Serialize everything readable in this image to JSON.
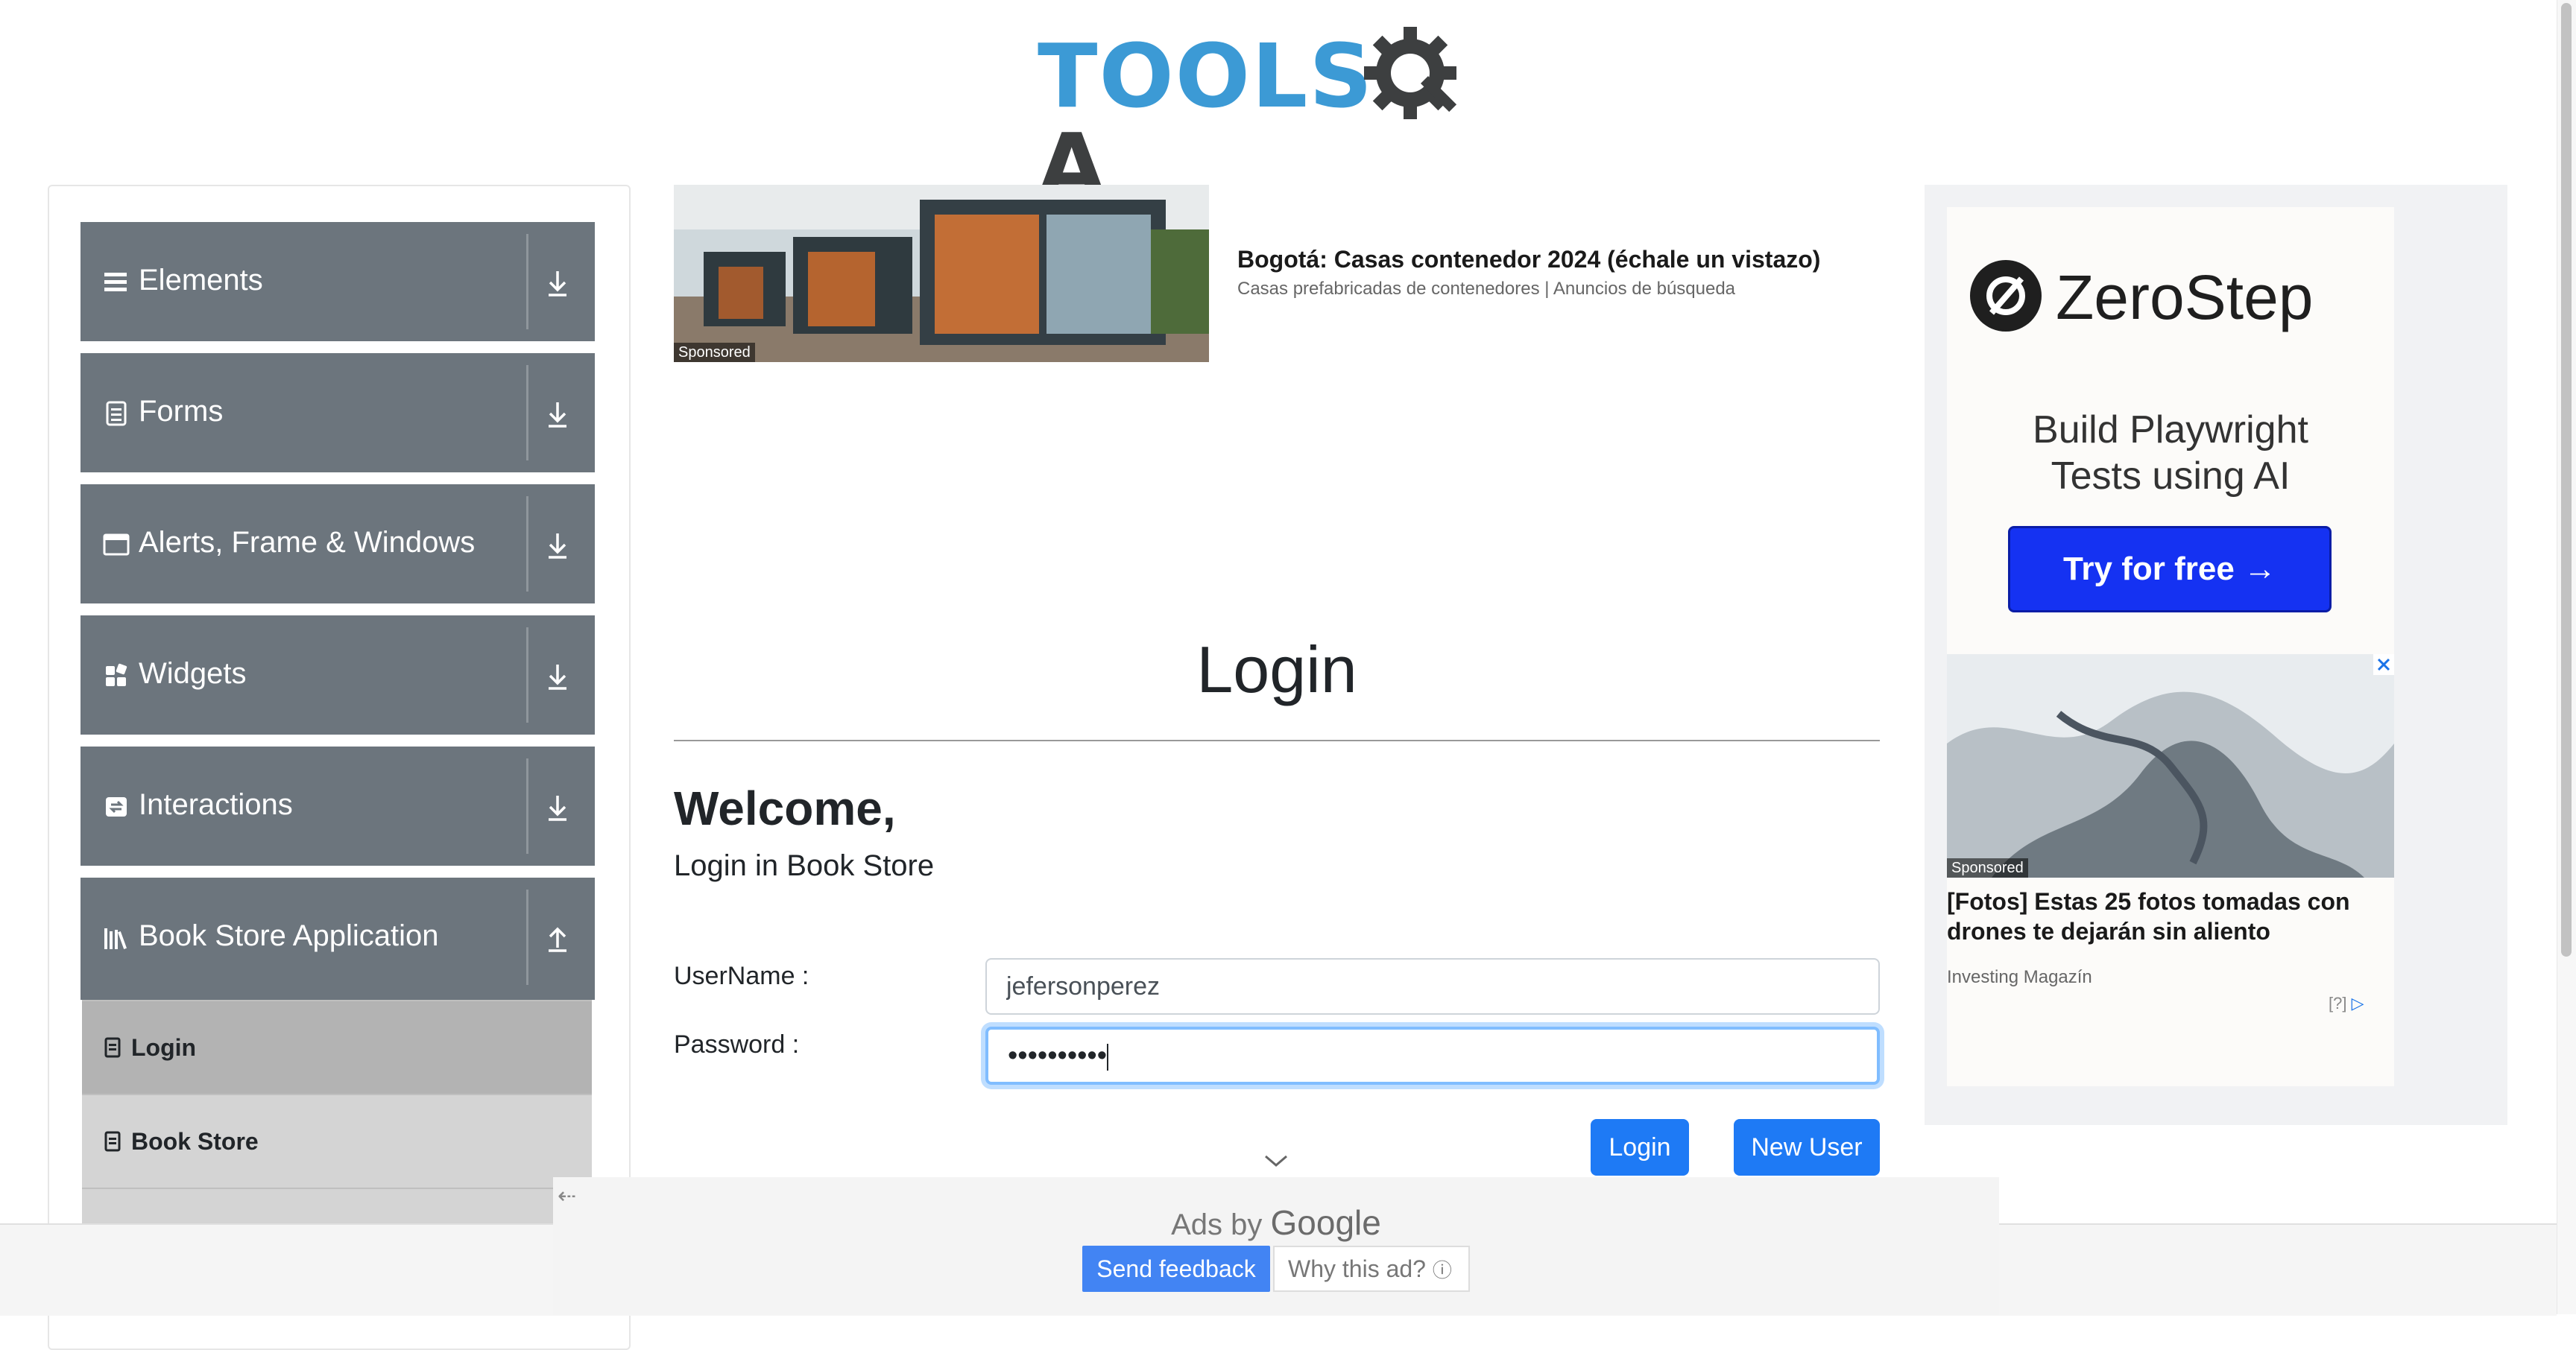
{
  "logo": {
    "text_tools": "TOOLS",
    "text_qa": "A"
  },
  "sidebar": {
    "groups": [
      {
        "label": "Elements",
        "icon": "hamburger-icon",
        "toggle": "download-icon"
      },
      {
        "label": "Forms",
        "icon": "document-icon",
        "toggle": "download-icon"
      },
      {
        "label": "Alerts, Frame & Windows",
        "icon": "window-icon",
        "toggle": "download-icon"
      },
      {
        "label": "Widgets",
        "icon": "widgets-icon",
        "toggle": "download-icon"
      },
      {
        "label": "Interactions",
        "icon": "interactions-icon",
        "toggle": "download-icon"
      },
      {
        "label": "Book Store Application",
        "icon": "books-icon",
        "toggle": "upload-icon"
      }
    ],
    "subitems": [
      {
        "label": "Login",
        "active": true
      },
      {
        "label": "Book Store",
        "active": false
      }
    ]
  },
  "top_ad": {
    "badge": "Sponsored",
    "title": "Bogotá: Casas contenedor 2024 (échale un vistazo)",
    "subtitle": "Casas prefabricadas de contenedores | Anuncios de búsqueda"
  },
  "main": {
    "title": "Login",
    "welcome": "Welcome,",
    "subtitle": "Login in Book Store",
    "username_label": "UserName :",
    "username_value": "jefersonperez",
    "password_label": "Password :",
    "password_value": "••••••••••",
    "login_button": "Login",
    "new_user_button": "New User"
  },
  "right_ad": {
    "brand": "ZeroStep",
    "tagline_1": "Build Playwright",
    "tagline_2": "Tests using AI",
    "cta": "Try for free →",
    "badge": "Sponsored",
    "story_title": "[Fotos] Estas 25 fotos tomadas con drones te dejarán sin aliento",
    "story_source": "Investing Magazín",
    "adchoices": "[?]"
  },
  "ads_bar": {
    "ads_by": "Ads by",
    "google": "Google",
    "send_feedback": "Send feedback",
    "why_this_ad": "Why this ad?",
    "info_icon": "ⓘ",
    "back_arrow": "⇠"
  },
  "colors": {
    "sidebar_group": "#6c757d",
    "primary_button": "#1e7af5",
    "zerostep_cta": "#1532f2"
  }
}
